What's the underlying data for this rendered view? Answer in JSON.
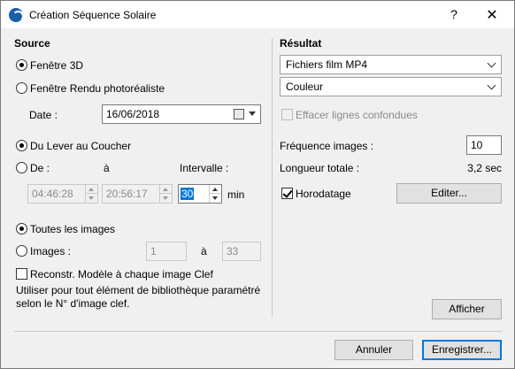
{
  "window": {
    "title": "Création Séquence Solaire",
    "help_label": "?",
    "close_label": "✕"
  },
  "source": {
    "heading": "Source",
    "view_options": [
      {
        "label": "Fenêtre 3D",
        "checked": true
      },
      {
        "label": "Fenêtre Rendu photoréaliste",
        "checked": false
      }
    ],
    "date_label": "Date :",
    "date_value": "16/06/2018",
    "time_options": [
      {
        "label": "Du Lever au Coucher",
        "checked": true
      },
      {
        "label": "De :",
        "checked": false
      }
    ],
    "to_label": "à",
    "interval_label": "Intervalle :",
    "start_time": "04:46:28",
    "end_time": "20:56:17",
    "interval_value": "30",
    "interval_unit": "min",
    "image_options": [
      {
        "label": "Toutes les images",
        "checked": true
      },
      {
        "label": "Images :",
        "checked": false
      }
    ],
    "image_from": "1",
    "image_to_label": "à",
    "image_to": "33",
    "rebuild_label": "Reconstr. Modèle à chaque image Clef",
    "rebuild_checked": false,
    "note": "Utiliser pour tout élément de bibliothèque paramétré selon le N° d'image clef."
  },
  "result": {
    "heading": "Résultat",
    "format_value": "Fichiers film MP4",
    "color_value": "Couleur",
    "hidden_lines_label": "Effacer lignes confondues",
    "hidden_lines_checked": false,
    "frame_rate_label": "Fréquence images :",
    "frame_rate_value": "10",
    "total_length_label": "Longueur totale :",
    "total_length_value": "3,2 sec",
    "timestamp_label": "Horodatage",
    "timestamp_checked": true,
    "edit_label": "Editer...",
    "show_label": "Afficher"
  },
  "footer": {
    "cancel_label": "Annuler",
    "save_label": "Enregistrer..."
  },
  "colors": {
    "accent": "#0078d7",
    "window_bg": "#f0f0f0"
  }
}
